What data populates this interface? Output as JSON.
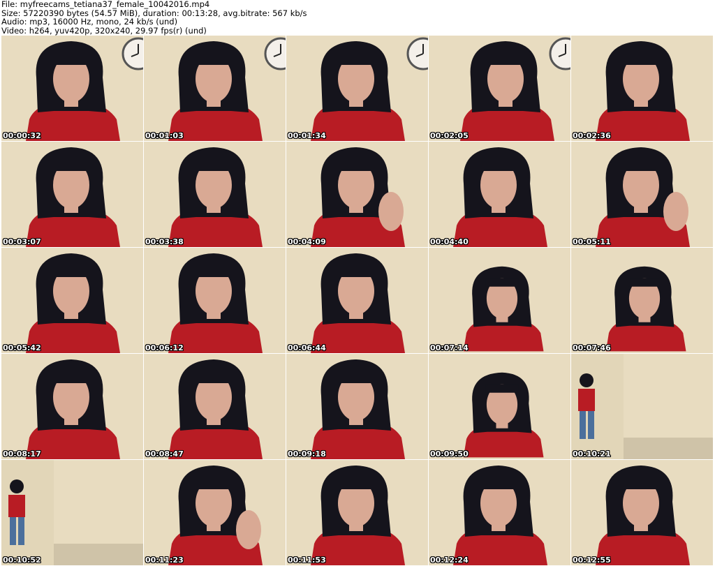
{
  "info": {
    "file": "File: myfreecams_tetiana37_female_10042016.mp4",
    "size": "Size: 57220390 bytes (54.57 MiB), duration: 00:13:28, avg.bitrate: 567 kb/s",
    "audio": "Audio: mp3, 16000 Hz, mono, 24 kb/s (und)",
    "video": "Video: h264, yuv420p, 320x240, 29.97 fps(r) (und)"
  },
  "colors": {
    "wall": "#e8dcc0",
    "shirt": "#b81c24",
    "hair": "#15141c",
    "skin": "#d9a994"
  },
  "thumbs": [
    {
      "ts": "00:00:32",
      "scene": "closeup",
      "clock": true
    },
    {
      "ts": "00:01:03",
      "scene": "closeup",
      "clock": true
    },
    {
      "ts": "00:01:34",
      "scene": "closeup",
      "clock": true
    },
    {
      "ts": "00:02:05",
      "scene": "side",
      "clock": true
    },
    {
      "ts": "00:02:36",
      "scene": "closeup",
      "clock": false
    },
    {
      "ts": "00:03:07",
      "scene": "closeup",
      "clock": false
    },
    {
      "ts": "00:03:38",
      "scene": "closeup",
      "clock": false
    },
    {
      "ts": "00:04:09",
      "scene": "hand",
      "clock": false
    },
    {
      "ts": "00:04:40",
      "scene": "closeup",
      "clock": false
    },
    {
      "ts": "00:05:11",
      "scene": "hand",
      "clock": false
    },
    {
      "ts": "00:05:42",
      "scene": "closeup",
      "clock": false
    },
    {
      "ts": "00:06:12",
      "scene": "closeup",
      "clock": false
    },
    {
      "ts": "00:06:44",
      "scene": "closeup",
      "clock": false
    },
    {
      "ts": "00:07:14",
      "scene": "small",
      "clock": false
    },
    {
      "ts": "00:07:46",
      "scene": "small",
      "clock": false
    },
    {
      "ts": "00:08:17",
      "scene": "closeup",
      "clock": false
    },
    {
      "ts": "00:08:47",
      "scene": "closeup",
      "clock": false
    },
    {
      "ts": "00:09:18",
      "scene": "closeup",
      "clock": false
    },
    {
      "ts": "00:09:50",
      "scene": "small",
      "clock": false
    },
    {
      "ts": "00:10:21",
      "scene": "room",
      "clock": false
    },
    {
      "ts": "00:10:52",
      "scene": "room",
      "clock": false
    },
    {
      "ts": "00:11:23",
      "scene": "hand",
      "clock": false
    },
    {
      "ts": "00:11:53",
      "scene": "closeup",
      "clock": false
    },
    {
      "ts": "00:12:24",
      "scene": "closeup",
      "clock": false
    },
    {
      "ts": "00:12:55",
      "scene": "closeup",
      "clock": false
    }
  ]
}
